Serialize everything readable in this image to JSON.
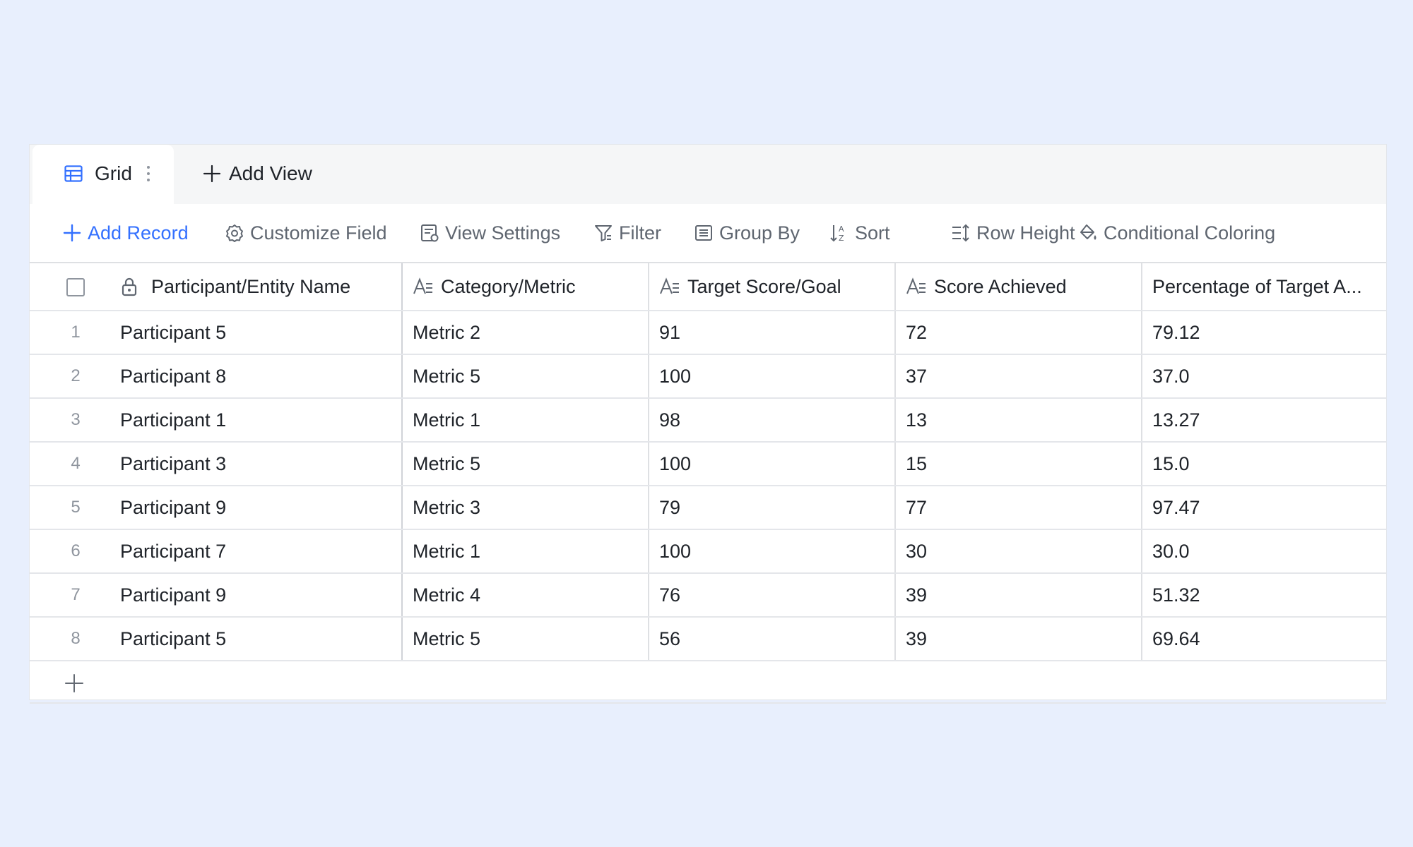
{
  "tabs": {
    "active_label": "Grid",
    "add_view_label": "Add View"
  },
  "toolbar": {
    "add_record": "Add Record",
    "customize_field": "Customize Field",
    "view_settings": "View Settings",
    "filter": "Filter",
    "group_by": "Group By",
    "sort": "Sort",
    "row_height": "Row Height",
    "conditional_coloring": "Conditional Coloring"
  },
  "colors": {
    "accent": "#3370ff",
    "background": "#e8effd"
  },
  "table": {
    "columns": [
      "Participant/Entity Name",
      "Category/Metric",
      "Target Score/Goal",
      "Score Achieved",
      "Percentage of Target A..."
    ],
    "rows": [
      {
        "num": "1",
        "name": "Participant 5",
        "metric": "Metric 2",
        "target": "91",
        "achieved": "72",
        "pct": "79.12"
      },
      {
        "num": "2",
        "name": "Participant 8",
        "metric": "Metric 5",
        "target": "100",
        "achieved": "37",
        "pct": "37.0"
      },
      {
        "num": "3",
        "name": "Participant 1",
        "metric": "Metric 1",
        "target": "98",
        "achieved": "13",
        "pct": "13.27"
      },
      {
        "num": "4",
        "name": "Participant 3",
        "metric": "Metric 5",
        "target": "100",
        "achieved": "15",
        "pct": "15.0"
      },
      {
        "num": "5",
        "name": "Participant 9",
        "metric": "Metric 3",
        "target": "79",
        "achieved": "77",
        "pct": "97.47"
      },
      {
        "num": "6",
        "name": "Participant 7",
        "metric": "Metric 1",
        "target": "100",
        "achieved": "30",
        "pct": "30.0"
      },
      {
        "num": "7",
        "name": "Participant 9",
        "metric": "Metric 4",
        "target": "76",
        "achieved": "39",
        "pct": "51.32"
      },
      {
        "num": "8",
        "name": "Participant 5",
        "metric": "Metric 5",
        "target": "56",
        "achieved": "39",
        "pct": "69.64"
      }
    ]
  }
}
